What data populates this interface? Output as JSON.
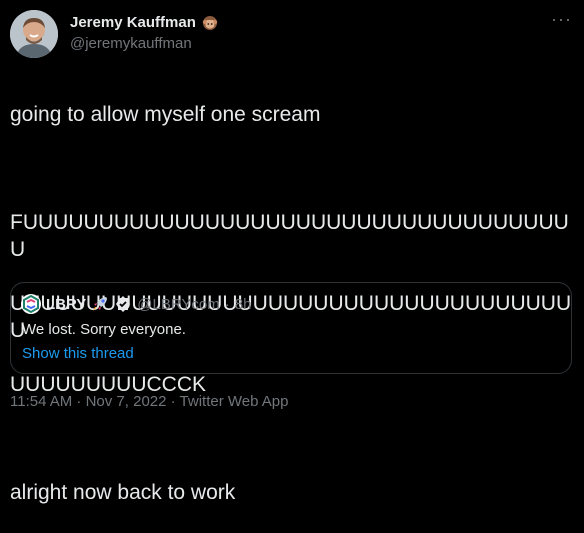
{
  "tweet": {
    "author": {
      "display_name": "Jeremy Kauffman",
      "handle": "@jeremykauffman",
      "badge_icon": "monkey-emoji-icon"
    },
    "text_lines": [
      "going to allow myself one scream",
      "",
      "FUUUUUUUUUUUUUUUUUUUUUUUUUUUUUUUUUUUUU",
      "UUUUUUUUUUUUUUUUUUUUUUUUUUUUUUUUUUUUUU",
      "UUUUUUUUUCCCK",
      "",
      "alright now back to work"
    ],
    "more_label": "···",
    "timestamp": "11:54 AM · Nov 7, 2022 · Twitter Web App"
  },
  "quote": {
    "display_name": "LBRY",
    "handle": "@LBRYcom",
    "separator": "·",
    "time": "8h",
    "text": "We lost. Sorry everyone.",
    "link_label": "Show this thread"
  },
  "colors": {
    "background": "#000000",
    "text": "#e7e9ea",
    "muted": "#71767b",
    "link": "#1d9bf0",
    "border": "#2f3336"
  }
}
